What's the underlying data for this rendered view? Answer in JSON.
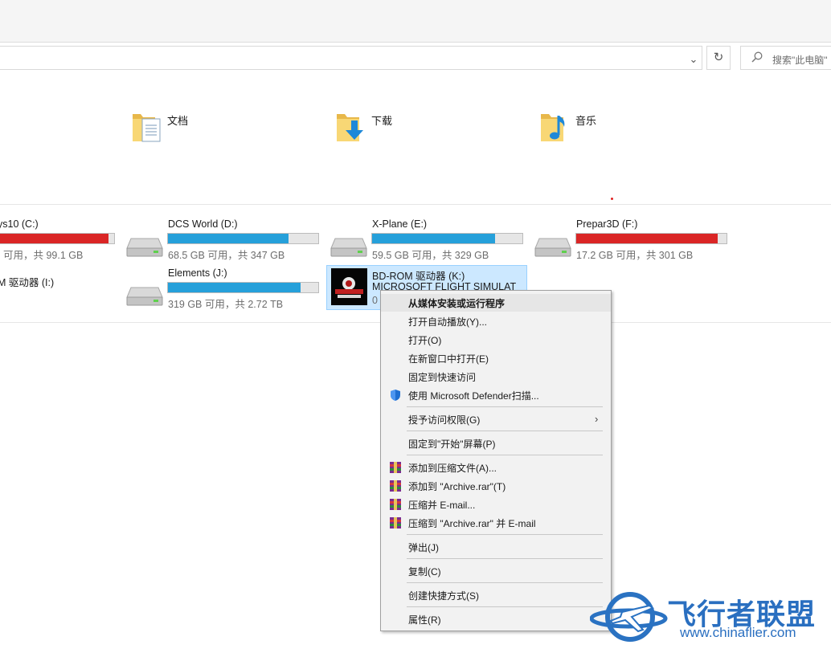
{
  "search": {
    "placeholder": "搜索\"此电脑\""
  },
  "folders": [
    {
      "label": "文档",
      "icon": "documents-folder-icon"
    },
    {
      "label": "下载",
      "icon": "downloads-folder-icon"
    },
    {
      "label": "音乐",
      "icon": "music-folder-icon"
    }
  ],
  "drives": [
    {
      "name": "ys10 (C:)",
      "space": "可用，共 99.1 GB",
      "fill": 0.95,
      "color": "#da2626"
    },
    {
      "name": "DCS World (D:)",
      "space": "68.5 GB 可用，共 347 GB",
      "fill": 0.8,
      "color": "#26a0da"
    },
    {
      "name": "X-Plane (E:)",
      "space": "59.5 GB 可用，共 329 GB",
      "fill": 0.82,
      "color": "#26a0da"
    },
    {
      "name": "Prepar3D (F:)",
      "space": "17.2 GB 可用，共 301 GB",
      "fill": 0.94,
      "color": "#da2626"
    },
    {
      "name": "M 驱动器 (I:)"
    },
    {
      "name": "Elements (J:)",
      "space": "319 GB 可用，共 2.72 TB",
      "fill": 0.88,
      "color": "#26a0da"
    },
    {
      "name": "BD-ROM 驱动器 (K:)",
      "volume": "MICROSOFT FLIGHT SIMULAT",
      "space": "0"
    }
  ],
  "context_menu": {
    "items": [
      {
        "label": "从媒体安装或运行程序",
        "bold": true
      },
      {
        "label": "打开自动播放(Y)..."
      },
      {
        "label": "打开(O)"
      },
      {
        "label": "在新窗口中打开(E)"
      },
      {
        "label": "固定到快速访问"
      },
      {
        "label": "使用 Microsoft Defender扫描...",
        "icon": "defender-shield-icon"
      },
      {
        "label": "授予访问权限(G)"
      },
      {
        "label": "固定到\"开始\"屏幕(P)"
      },
      {
        "label": "添加到压缩文件(A)...",
        "icon": "winrar-icon"
      },
      {
        "label": "添加到 \"Archive.rar\"(T)",
        "icon": "winrar-icon"
      },
      {
        "label": "压缩并 E-mail...",
        "icon": "winrar-icon"
      },
      {
        "label": "压缩到 \"Archive.rar\" 并 E-mail",
        "icon": "winrar-icon"
      },
      {
        "label": "弹出(J)"
      },
      {
        "label": "复制(C)"
      },
      {
        "label": "创建快捷方式(S)"
      },
      {
        "label": "属性(R)"
      }
    ]
  },
  "watermark": {
    "title": "飞行者联盟",
    "url": "www.chinaflier.com"
  },
  "colors": {
    "accent": "#26a0da",
    "warning": "#da2626",
    "selection": "#cce8ff"
  }
}
